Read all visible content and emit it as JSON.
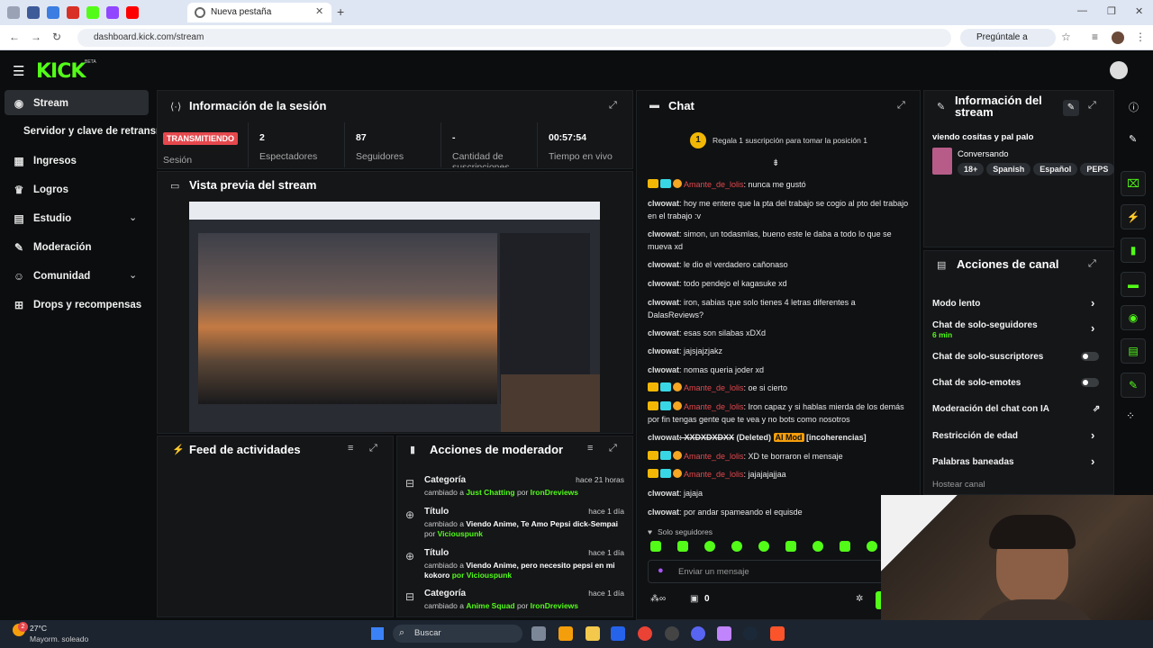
{
  "browser": {
    "active_tab": "Nueva pestaña",
    "url": "dashboard.kick.com/stream",
    "ask_google": "Pregúntale a Google"
  },
  "brand": {
    "logo": "KICK",
    "beta": "BETA",
    "accent": "#53fc18"
  },
  "sidebar": {
    "items": [
      {
        "label": "Stream",
        "icon": "broadcast-icon"
      },
      {
        "label": "Servidor y clave de retransm"
      },
      {
        "label": "Ingresos",
        "icon": "chart-icon"
      },
      {
        "label": "Logros",
        "icon": "trophy-icon"
      },
      {
        "label": "Estudio",
        "icon": "studio-icon"
      },
      {
        "label": "Moderación",
        "icon": "wrench-icon"
      },
      {
        "label": "Comunidad",
        "icon": "people-icon"
      },
      {
        "label": "Drops y recompensas",
        "icon": "drops-icon"
      }
    ]
  },
  "session": {
    "title": "Información de la sesión",
    "live_badge": "TRANSMITIENDO",
    "live_label": "Sesión",
    "stats": [
      {
        "value": "2",
        "label": "Espectadores"
      },
      {
        "value": "87",
        "label": "Seguidores"
      },
      {
        "value": "-",
        "label": "Cantidad de suscripciones"
      },
      {
        "value": "00:57:54",
        "label": "Tiempo en vivo"
      }
    ]
  },
  "preview": {
    "title": "Vista previa del stream"
  },
  "feed": {
    "title": "Feed de actividades"
  },
  "modactions": {
    "title": "Acciones de moderador",
    "rows": [
      {
        "title": "Categoría",
        "time": "hace 21 horas",
        "line1_a": "cambiado a ",
        "line1_b": "Just Chatting",
        "line1_c": " por ",
        "line1_d": "IronDreviews",
        "line2_a": "",
        "line2_b": ""
      },
      {
        "title": "Título",
        "time": "hace 1 día",
        "line1_a": "cambiado a ",
        "line1_b": "Viendo Anime, Te Amo Pepsi dick-Sempai",
        "line1_c": "",
        "line1_d": "",
        "line2_a": "por ",
        "line2_b": "Viciouspunk"
      },
      {
        "title": "Título",
        "time": "hace 1 día",
        "line1_a": "cambiado a ",
        "line1_b": "Viendo Anime, pero necesito pepsi en mi",
        "line1_c": "",
        "line1_d": "",
        "line2_a": "kokoro",
        "line2_b": " por Viciouspunk"
      },
      {
        "title": "Categoría",
        "time": "hace 1 día",
        "line1_a": "cambiado a ",
        "line1_b": "Anime Squad",
        "line1_c": " por ",
        "line1_d": "IronDreviews",
        "line2_a": "",
        "line2_b": ""
      }
    ]
  },
  "chat": {
    "title": "Chat",
    "gift_text": "Regala 1 suscripción para tomar la posición 1",
    "gift_badge": "1",
    "messages": [
      {
        "user": "Amante_de_lolis",
        "text": ": nunca me gustó",
        "badges": true
      },
      {
        "user": "clwowat",
        "text": ": hoy me entere que la pta del trabajo se cogio al pto del trabajo en el trabajo :v",
        "badges": false
      },
      {
        "user": "clwowat",
        "text": ": simon, un todasmlas, bueno este le daba a todo lo que se mueva xd",
        "badges": false
      },
      {
        "user": "clwowat",
        "text": ": le dio el verdadero cañonaso",
        "badges": false
      },
      {
        "user": "clwowat",
        "text": ": todo pendejo el kagasuke xd",
        "badges": false
      },
      {
        "user": "clwowat",
        "text": ": iron, sabias que solo tienes 4 letras diferentes a DalasReviews?",
        "badges": false
      },
      {
        "user": "clwowat",
        "text": ": esas son silabas xDXd",
        "badges": false
      },
      {
        "user": "clwowat",
        "text": ": jajsjajzjakz",
        "badges": false
      },
      {
        "user": "clwowat",
        "text": ": nomas queria joder xd",
        "badges": false
      },
      {
        "user": "Amante_de_lolis",
        "text": ": oe si cierto",
        "badges": true
      },
      {
        "user": "Amante_de_lolis",
        "text": ": Iron capaz y si hablas mierda de los demás por fin tengas gente que te vea y no bots como nosotros",
        "badges": true
      },
      {
        "user": "clwowat",
        "text": ": XXDXDXDXX",
        "badges": false,
        "deleted": "(Deleted)",
        "mod": "AI Mod",
        "reason": "[incoherencias]"
      },
      {
        "user": "Amante_de_lolis",
        "text": ": XD te borraron el mensaje",
        "badges": true
      },
      {
        "user": "Amante_de_lolis",
        "text": ": jajajajajjaa",
        "badges": true
      },
      {
        "user": "clwowat",
        "text": ": jajaja",
        "badges": false
      },
      {
        "user": "clwowat",
        "text": ": por andar spameando el equisde",
        "badges": false
      }
    ],
    "followers_only": "Solo seguidores",
    "input_placeholder": "Enviar un mensaje",
    "counter": "0"
  },
  "streaminfo": {
    "title": "Información del stream",
    "stream_title": "viendo cositas y pal palo",
    "category": "Conversando",
    "tags": [
      "18+",
      "Spanish",
      "Español",
      "PEPS"
    ]
  },
  "channel": {
    "title": "Acciones de canal",
    "rows": [
      {
        "label": "Modo lento",
        "type": "arrow"
      },
      {
        "label": "Chat de solo-seguidores",
        "sub": "6 min",
        "type": "arrow"
      },
      {
        "label": "Chat de solo-suscriptores",
        "type": "toggle"
      },
      {
        "label": "Chat de solo-emotes",
        "type": "toggle"
      },
      {
        "label": "Moderación del chat con IA",
        "type": "external"
      },
      {
        "label": "Restricción de edad",
        "type": "arrow"
      },
      {
        "label": "Palabras baneadas",
        "type": "arrow"
      },
      {
        "label": "Hostear canal",
        "type": "none"
      }
    ]
  },
  "taskbar": {
    "weather_temp": "27°C",
    "weather_desc": "Mayorm. soleado",
    "search": "Buscar",
    "notif": "2"
  }
}
